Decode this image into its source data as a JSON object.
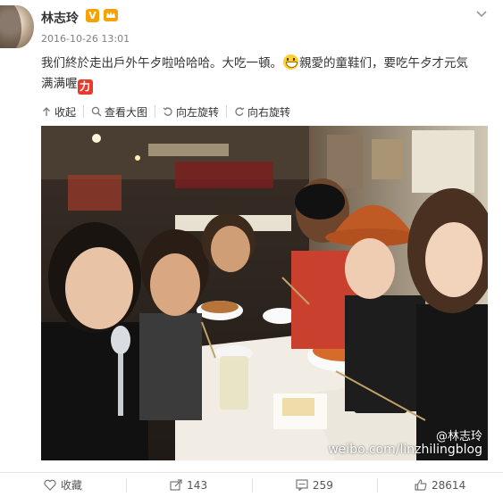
{
  "post": {
    "author": "林志玲",
    "verified_badge": "V",
    "timestamp": "2016-10-26 13:01",
    "text_line1": "我们終於走出戶外午歺啦哈哈哈。大吃一頓。",
    "text_after_emoji1": "親愛的童鞋们，要吃午歺才元気",
    "text_line2": "满满喔",
    "emoji": [
      "grinning-face",
      "power-fist"
    ]
  },
  "toolbar": {
    "collapse": "收起",
    "view_large": "查看大图",
    "rotate_left": "向左旋转",
    "rotate_right": "向右旋转"
  },
  "photo": {
    "watermark_user": "@林志玲",
    "watermark_url": "weibo.com/linzhilingblog"
  },
  "footer": {
    "favorite_label": "收藏",
    "repost_count": "143",
    "comment_count": "259",
    "like_count": "28614"
  },
  "colors": {
    "accent": "#eb7350",
    "vip_orange": "#f7a200",
    "text": "#333333",
    "muted": "#808080"
  }
}
